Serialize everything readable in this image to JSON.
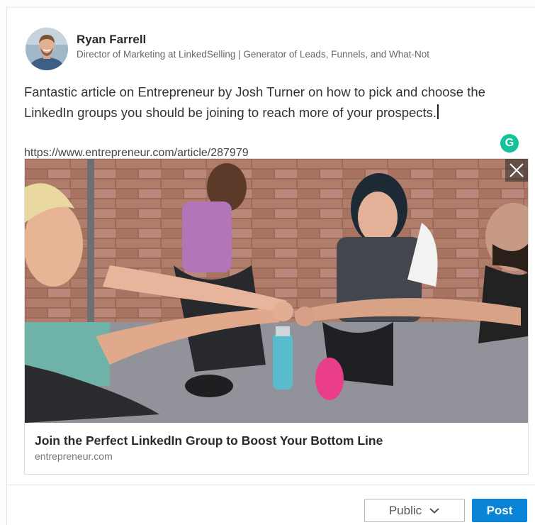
{
  "author": {
    "name": "Ryan Farrell",
    "headline": "Director of Marketing at LinkedSelling | Generator of Leads, Funnels, and What-Not"
  },
  "post": {
    "text": "Fantastic article on Entrepreneur by Josh Turner on how to pick and choose the LinkedIn groups you should be joining to reach more of your prospects.",
    "url": "https://www.entrepreneur.com/article/287979"
  },
  "grammarly": {
    "glyph": "G",
    "color": "#15c39a"
  },
  "preview": {
    "title": "Join the Perfect LinkedIn Group to Boost Your Bottom Line",
    "domain": "entrepreneur.com"
  },
  "footer": {
    "visibility_label": "Public",
    "post_label": "Post",
    "post_color": "#0a84d6"
  },
  "icons": [
    "avatar",
    "grammarly-icon",
    "close-icon",
    "chevron-down-icon"
  ]
}
